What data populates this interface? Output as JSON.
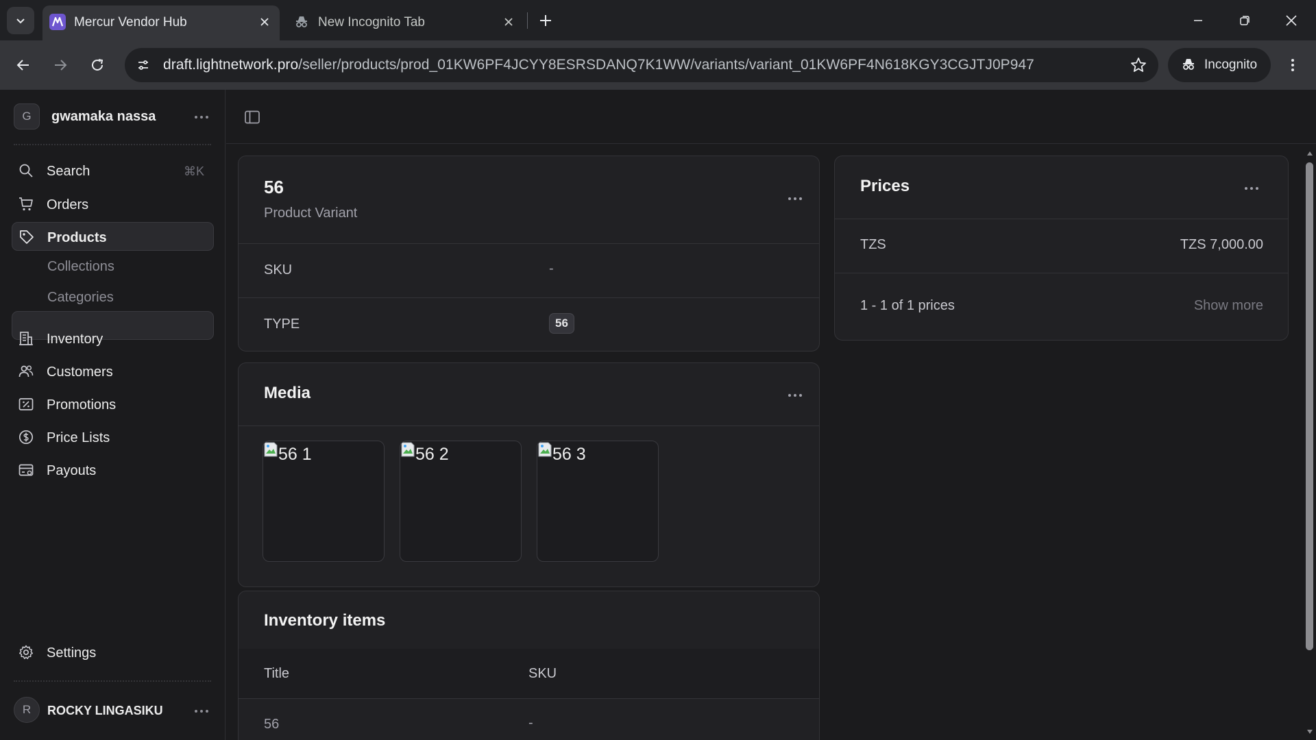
{
  "browser": {
    "tabs": [
      {
        "title": "Mercur Vendor Hub",
        "active": true
      },
      {
        "title": "New Incognito Tab",
        "active": false
      }
    ],
    "url_host": "draft.lightnetwork.pro",
    "url_path": "/seller/products/prod_01KW6PF4JCYY8ESRSDANQ7K1WW/variants/variant_01KW6PF4N618KGY3CGJTJ0P947",
    "incognito_label": "Incognito"
  },
  "sidebar": {
    "store_initial": "G",
    "store_name": "gwamaka nassa",
    "search_label": "Search",
    "search_shortcut": "⌘K",
    "items": [
      {
        "label": "Orders",
        "icon": "cart-icon"
      },
      {
        "label": "Products",
        "icon": "tag-icon",
        "active": true
      },
      {
        "label": "Inventory",
        "icon": "building-icon"
      },
      {
        "label": "Customers",
        "icon": "users-icon"
      },
      {
        "label": "Promotions",
        "icon": "receipt-percent-icon"
      },
      {
        "label": "Price Lists",
        "icon": "currency-dollar-icon"
      },
      {
        "label": "Payouts",
        "icon": "credit-card-icon"
      }
    ],
    "sub_items": [
      "Collections",
      "Categories"
    ],
    "settings_label": "Settings",
    "user_initial": "R",
    "user_name": "ROCKY LINGASIKU"
  },
  "variant": {
    "title": "56",
    "subtitle": "Product Variant",
    "sku_label": "SKU",
    "sku_value": "-",
    "type_label": "TYPE",
    "type_value": "56"
  },
  "media": {
    "title": "Media",
    "images": [
      {
        "alt": "56 1"
      },
      {
        "alt": "56 2"
      },
      {
        "alt": "56 3"
      }
    ]
  },
  "inventory": {
    "title": "Inventory items",
    "columns": [
      "Title",
      "SKU"
    ],
    "rows": [
      {
        "title": "56",
        "sku": "-"
      }
    ]
  },
  "prices": {
    "title": "Prices",
    "rows": [
      {
        "currency": "TZS",
        "amount": "TZS 7,000.00"
      }
    ],
    "pagination": "1 - 1 of 1 prices",
    "show_more": "Show more"
  },
  "colors": {
    "background": "#1b1b1d",
    "card": "#212124",
    "border": "#333337",
    "accent_favicon": "#6e56cf"
  }
}
